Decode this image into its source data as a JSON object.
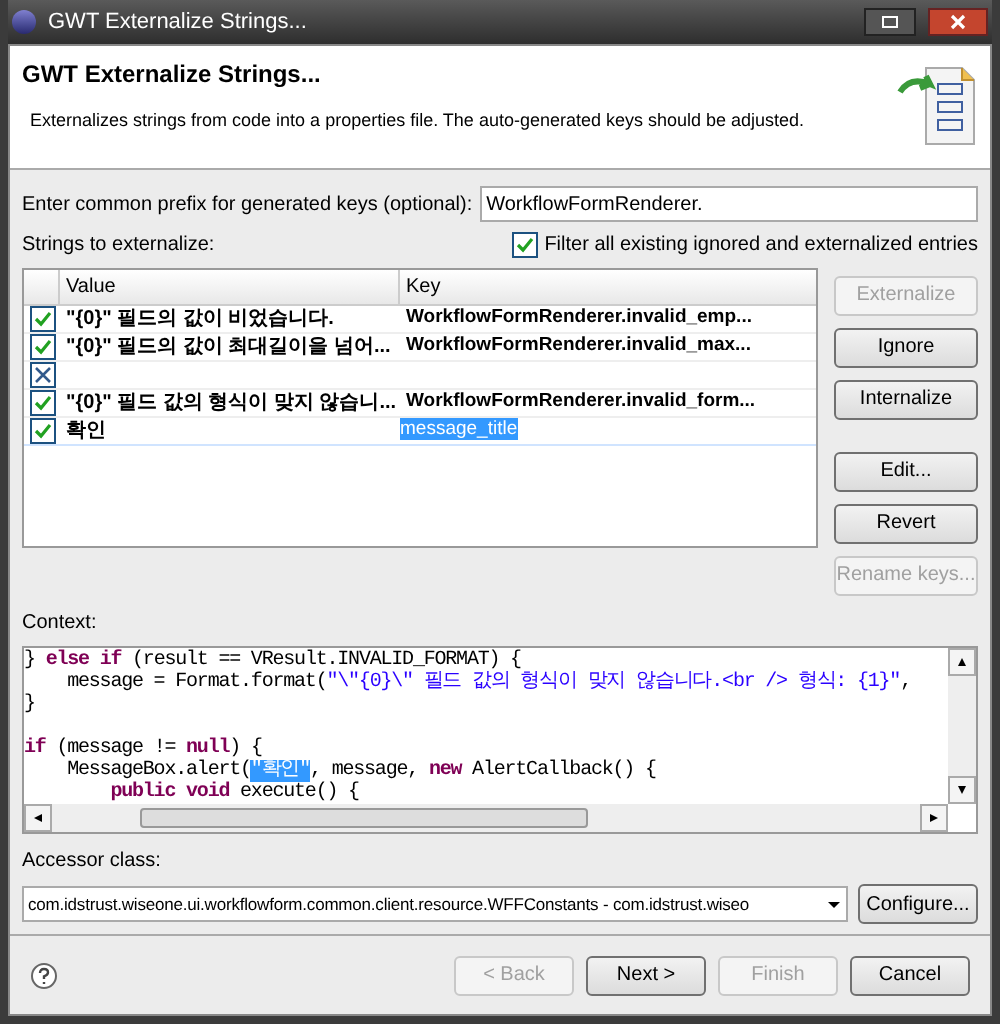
{
  "window": {
    "title": "GWT Externalize Strings..."
  },
  "header": {
    "title": "GWT Externalize Strings...",
    "description": "Externalizes strings from code into a properties file. The auto-generated keys should be adjusted."
  },
  "prefix": {
    "label": "Enter common prefix for generated keys (optional):",
    "value": "WorkflowFormRenderer."
  },
  "strings_label": "Strings to externalize:",
  "filter": {
    "label": "Filter all existing ignored and externalized entries",
    "checked": true
  },
  "table": {
    "columns": [
      "Value",
      "Key"
    ],
    "rows": [
      {
        "kind": "externalize",
        "checked": true,
        "value": "\"{0}\" 필드의 값이 비었습니다.",
        "key": "WorkflowFormRenderer.invalid_emp...",
        "selected": false
      },
      {
        "kind": "externalize",
        "checked": true,
        "value": "\"{0}\" 필드의 값이 최대길이을 넘어...",
        "key": "WorkflowFormRenderer.invalid_max...",
        "selected": false
      },
      {
        "kind": "ignore",
        "checked": true,
        "selected": false
      },
      {
        "kind": "externalize",
        "checked": true,
        "value": "\"{0}\" 필드 값의 형식이 맞지 않습니...",
        "key": "WorkflowFormRenderer.invalid_form...",
        "selected": false
      },
      {
        "kind": "externalize",
        "checked": true,
        "value": "확인",
        "key": "message_title",
        "selected": true
      }
    ]
  },
  "side_buttons": [
    {
      "label": "Externalize",
      "disabled": true
    },
    {
      "label": "Ignore",
      "disabled": false
    },
    {
      "label": "Internalize",
      "disabled": false
    },
    {
      "label": "Edit...",
      "disabled": false
    },
    {
      "label": "Revert",
      "disabled": false
    },
    {
      "label": "Rename keys...",
      "disabled": true
    }
  ],
  "context": {
    "label": "Context:",
    "lines": [
      {
        "blank_before": false,
        "segments": [
          {
            "kind": "plain",
            "text": "} "
          },
          {
            "kind": "kw",
            "text": "else if"
          },
          {
            "kind": "plain",
            "text": " (result == VResult.INVALID_FORMAT) {"
          }
        ]
      },
      {
        "blank_before": false,
        "segments": [
          {
            "kind": "plain",
            "text": "    message = Format.format("
          },
          {
            "kind": "str",
            "text": "\"\\\"{0}\\\" 필드 값의 형식이 맞지 않습니다.<br /> 형식: {1}\""
          },
          {
            "kind": "plain",
            "text": ","
          }
        ]
      },
      {
        "blank_before": false,
        "segments": [
          {
            "kind": "plain",
            "text": "}"
          }
        ]
      },
      {
        "blank_before": true,
        "segments": [
          {
            "kind": "kw",
            "text": "if"
          },
          {
            "kind": "plain",
            "text": " (message != "
          },
          {
            "kind": "kw",
            "text": "null"
          },
          {
            "kind": "plain",
            "text": ") {"
          }
        ]
      },
      {
        "blank_before": false,
        "segments": [
          {
            "kind": "plain",
            "text": "    MessageBox.alert("
          },
          {
            "kind": "sel",
            "text": "\"확인\""
          },
          {
            "kind": "plain",
            "text": ", message, "
          },
          {
            "kind": "kw",
            "text": "new"
          },
          {
            "kind": "plain",
            "text": " AlertCallback() {"
          }
        ]
      },
      {
        "blank_before": false,
        "segments": [
          {
            "kind": "kw",
            "text": "        public void"
          },
          {
            "kind": "plain",
            "text": " execute() {"
          }
        ]
      }
    ]
  },
  "accessor": {
    "label": "Accessor class:",
    "value": "com.idstrust.wiseone.ui.workflowform.common.client.resource.WFFConstants - com.idstrust.wiseo",
    "button": "Configure..."
  },
  "footer_buttons": [
    {
      "label": "< Back",
      "disabled": true
    },
    {
      "label": "Next >",
      "disabled": false
    },
    {
      "label": "Finish",
      "disabled": true
    },
    {
      "label": "Cancel",
      "disabled": false
    }
  ]
}
